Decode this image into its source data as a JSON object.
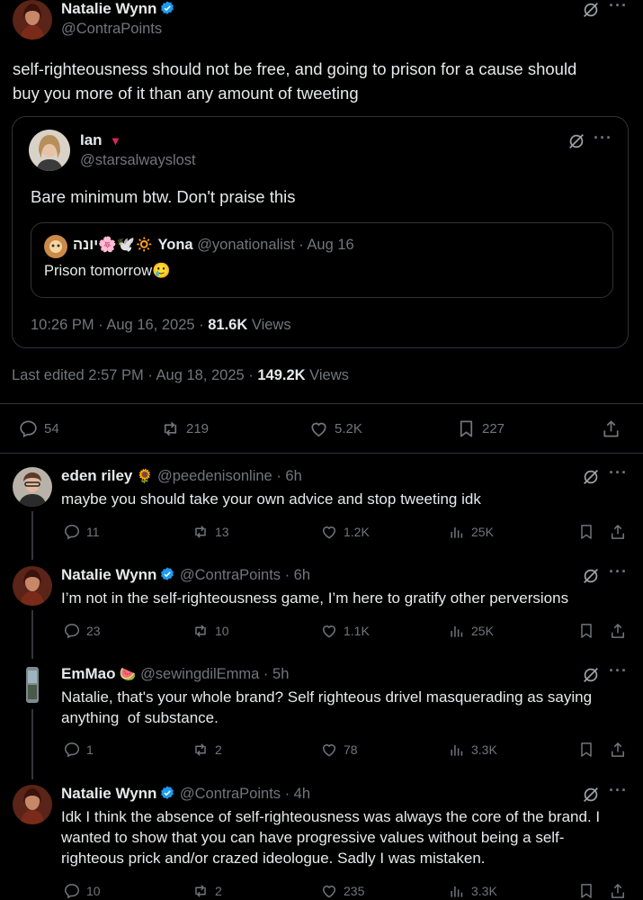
{
  "main_tweet": {
    "name": "Natalie Wynn",
    "handle": "@ContraPoints",
    "text_line1": "self-righteousness should not be free, and going to prison for a cause should",
    "text_line2": "buy you more of it than any amount of tweeting",
    "edited": "Last edited 2:57 PM · Aug 18, 2025 ·",
    "views_count": "149.2K",
    "views_label": "Views",
    "replies": "54",
    "reposts": "219",
    "likes": "5.2K",
    "bookmarks": "227"
  },
  "quoted_tweet": {
    "name": "Ian",
    "handle": "@starsalwayslost",
    "text": "Bare minimum btw. Don't praise this",
    "meta": "10:26 PM · Aug 16, 2025 ·",
    "views_count": "81.6K",
    "views_label": "Views"
  },
  "nested_quote": {
    "name_prefix": "יונה🌸🕊️🔅",
    "name": "Yona",
    "handle_time": "@yonationalist · Aug 16",
    "text": "Prison tomorrow🥲"
  },
  "replies": [
    {
      "name": "eden riley",
      "badge": "🌻",
      "handle_time": "@peedenisonline · 6h",
      "text_lines": [
        "maybe you should take your own advice and stop tweeting idk"
      ],
      "replies": "11",
      "reposts": "13",
      "likes": "1.2K",
      "views": "25K"
    },
    {
      "name": "Natalie Wynn",
      "handle_time": "@ContraPoints · 6h",
      "text_lines": [
        "I’m not in the self-righteousness game, I’m here to gratify other perversions"
      ],
      "replies": "23",
      "reposts": "10",
      "likes": "1.1K",
      "views": "25K"
    },
    {
      "name": "EmMao",
      "badge": "🍉",
      "handle_time": "@sewingdilEmma · 5h",
      "text_lines": [
        "Natalie, that's your whole brand? Self righteous drivel masquerading as saying",
        "anything  of substance."
      ],
      "replies": "1",
      "reposts": "2",
      "likes": "78",
      "views": "3.3K"
    },
    {
      "name": "Natalie Wynn",
      "handle_time": "@ContraPoints · 4h",
      "text_lines": [
        "Idk I think the absence of self-righteousness was always the core of the brand. I",
        "wanted to show that you can have progressive values without being a self-",
        "righteous prick and/or crazed ideologue. Sadly I was mistaken."
      ],
      "replies": "10",
      "reposts": "2",
      "likes": "235",
      "views": "3.3K"
    }
  ],
  "colors": {
    "background": "#000000",
    "text": "#e7e9ea",
    "muted": "#71767b",
    "verified": "#1d9bf0",
    "border": "#2f3336"
  }
}
